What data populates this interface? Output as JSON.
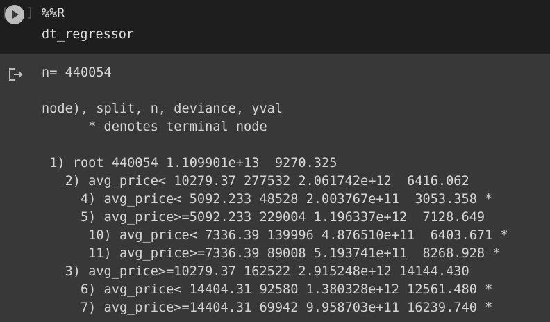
{
  "cell": {
    "bracket_left": "[",
    "bracket_right": "]",
    "code_lines": [
      "%%R",
      "dt_regressor"
    ]
  },
  "output": {
    "lines": [
      "n= 440054",
      "",
      "node), split, n, deviance, yval",
      "      * denotes terminal node",
      "",
      " 1) root 440054 1.109901e+13  9270.325  ",
      "   2) avg_price< 10279.37 277532 2.061742e+12  6416.062  ",
      "     4) avg_price< 5092.233 48528 2.003767e+11  3053.358 *",
      "     5) avg_price>=5092.233 229004 1.196337e+12  7128.649  ",
      "      10) avg_price< 7336.39 139996 4.876510e+11  6403.671 *",
      "      11) avg_price>=7336.39 89008 5.193741e+11  8268.928 *",
      "   3) avg_price>=10279.37 162522 2.915248e+12 14144.430  ",
      "     6) avg_price< 14404.31 92580 1.380328e+12 12561.480 *",
      "     7) avg_price>=14404.31 69942 9.958703e+11 16239.740 *"
    ]
  }
}
